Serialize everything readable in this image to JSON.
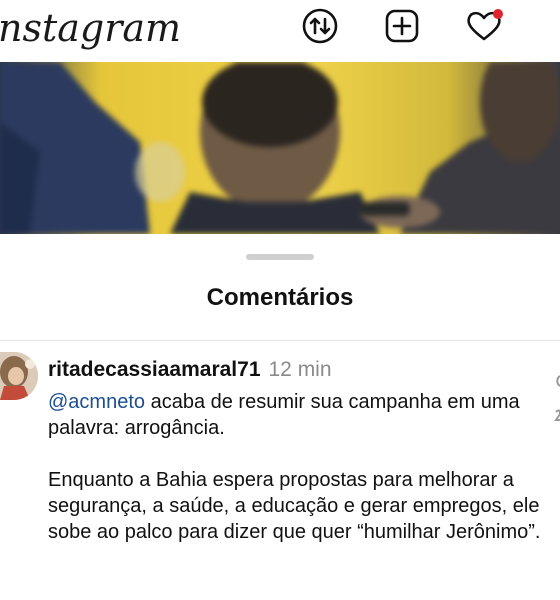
{
  "app": {
    "logo_text": "nstagram"
  },
  "header": {
    "icons": [
      "updown-arrows-icon",
      "plus-square-icon",
      "heart-icon"
    ],
    "notification_dot_color": "#e0242b"
  },
  "sheet": {
    "title": "Comentários"
  },
  "comment": {
    "username": "ritadecassiaamaral71",
    "time": "12 min",
    "mention": "@acmneto",
    "text_after_mention": " acaba de resumir sua campanha em uma palavra: arrogância.\n\nEnquanto a Bahia espera propostas para melhorar a segurança, a saúde, a educação e gerar empregos, ele sobe ao palco para dizer que quer “humilhar Jerônimo”."
  }
}
